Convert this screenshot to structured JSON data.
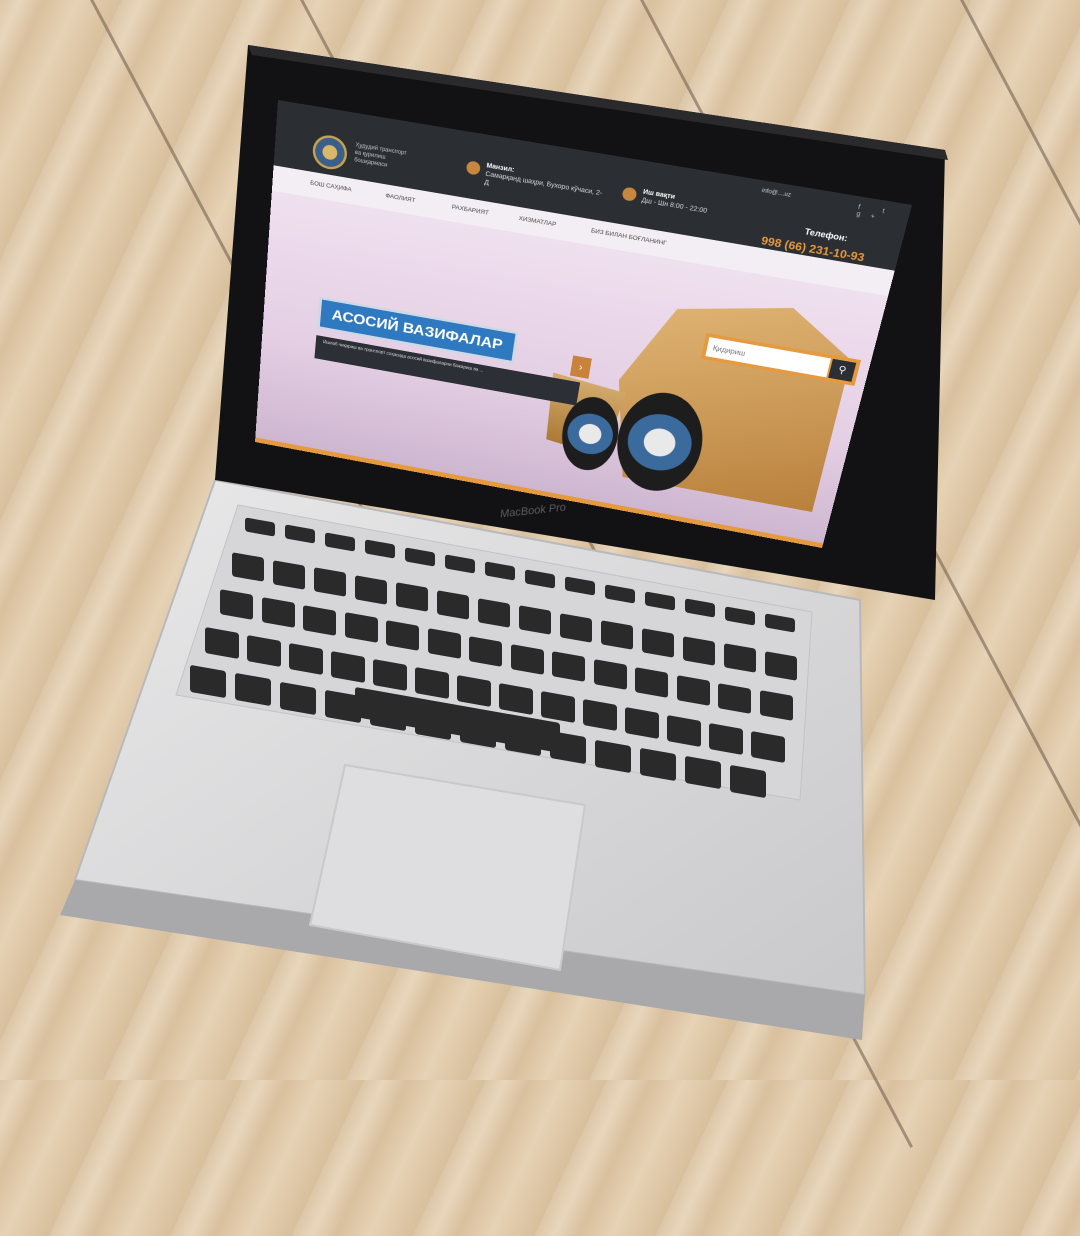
{
  "site": {
    "org_lines": [
      "Ҳудудий транспорт",
      "ва қурилиш",
      "бошқармаси"
    ],
    "address_label": "Манзил:",
    "address_value": "Самарқанд шаҳри, Бухоро кўчаси, 2-Д",
    "hours_label": "Иш вақти",
    "hours_value": "Дш - Шн 8:00 - 22:00",
    "phone_label": "Телефон:",
    "phone_number": "998 (66) 231-10-93",
    "email": "info@....uz",
    "socials": "f t g+"
  },
  "nav": {
    "items": [
      "Бош саҳифа",
      "Фаолият",
      "Рахбарият",
      "Хизматлар",
      "Биз билан боғланинг"
    ]
  },
  "search": {
    "placeholder": "Қидириш",
    "icon": "search-icon"
  },
  "hero": {
    "title": "АСОСИЙ ВАЗИФАЛАР",
    "description": "Ишлаб чиқариш ва транспорт соҳасида асосий вазифаларни бажариш ва ...",
    "arrow_icon": "chevron-right-icon"
  },
  "laptop": {
    "brand": "MacBook Pro"
  },
  "colors": {
    "accent": "#e59a3f",
    "header": "#2b2e33",
    "title_bg": "#2f79c0"
  }
}
